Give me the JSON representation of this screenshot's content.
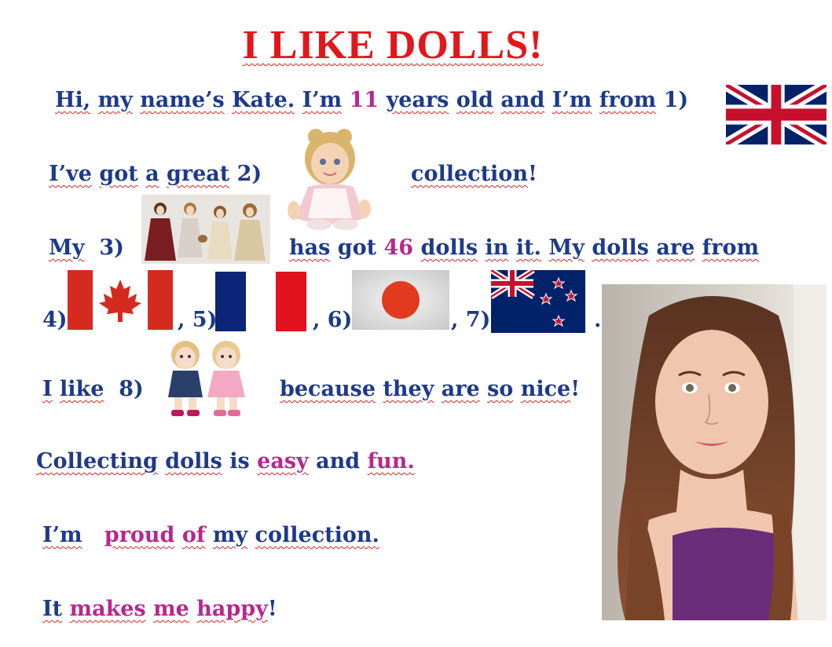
{
  "title": "I LIKE DOLLS!",
  "line1": {
    "hi": "Hi,",
    "my": "my",
    "name": "name’s",
    "kate": "Kate.",
    "im": "I’m",
    "age": "11",
    "years": "years",
    "old": "old",
    "and": "and",
    "im2": "I’m",
    "from": "from",
    "num": "1)"
  },
  "line2": {
    "ive": "I’ve",
    "got": "got",
    "a": "a",
    "great": "great",
    "num": "2)",
    "collection": "collection",
    "excl": "!"
  },
  "line3": {
    "my": "My",
    "num": "3)",
    "has": "has",
    "got": "got",
    "count": "46",
    "dolls": "dolls",
    "in": "in",
    "it": "it.",
    "my2": "My",
    "dolls2": "dolls",
    "are": "are",
    "from": "from"
  },
  "line4": {
    "n4": "4)",
    "n5": ", 5)",
    "n6": ", 6)",
    "n7": ", 7)",
    "dot": "."
  },
  "line5": {
    "i": "I",
    "like": "like",
    "num": "8)",
    "because": "because",
    "they": "they",
    "are": "are",
    "so": "so",
    "nice": "nice",
    "excl": "!"
  },
  "line6": {
    "collecting": "Collecting",
    "dolls": "dolls",
    "is": "is",
    "easy": "easy",
    "and": "and",
    "fun": "fun."
  },
  "line7": {
    "im": "I’m",
    "proud": "proud",
    "of": "of",
    "my": "my",
    "collection": "collection."
  },
  "line8": {
    "it": "It",
    "makes": "makes",
    "me": "me",
    "happy": "happy",
    "excl": "!"
  },
  "colors": {
    "title": "#e3161c",
    "text": "#1d3a8a",
    "accent": "#b8278d"
  }
}
